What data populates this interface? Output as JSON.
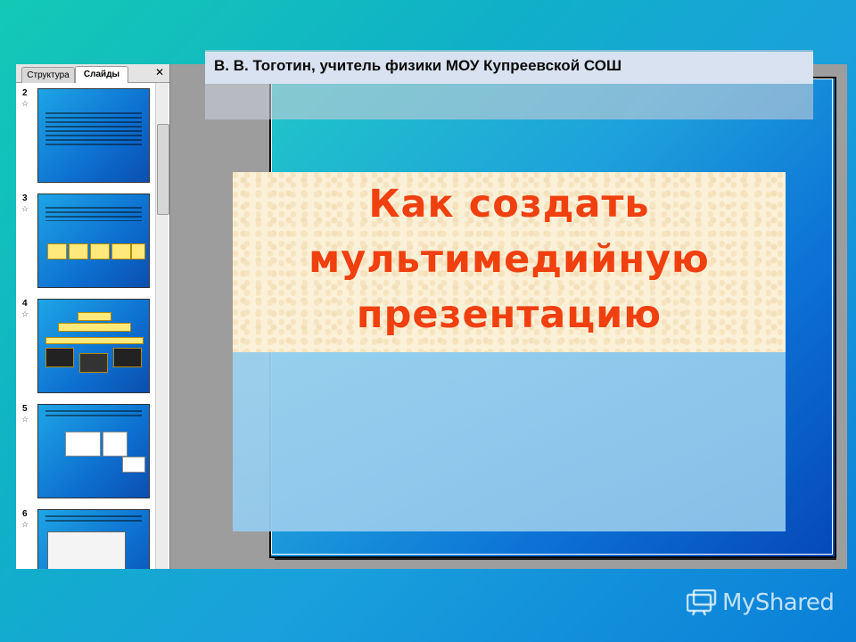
{
  "author_banner": {
    "text": "В. В. Тоготин, учитель физики МОУ Купреевской СОШ"
  },
  "title": {
    "text": "Как создать мультимедийную презентацию"
  },
  "slides_panel": {
    "tabs": [
      {
        "label": "Структура"
      },
      {
        "label": "Слайды"
      }
    ],
    "close_icon": "close-icon",
    "thumbnails": [
      {
        "number": "2",
        "star_icon": "star-icon"
      },
      {
        "number": "3",
        "star_icon": "star-icon"
      },
      {
        "number": "4",
        "star_icon": "star-icon"
      },
      {
        "number": "5",
        "star_icon": "star-icon"
      },
      {
        "number": "6",
        "star_icon": "star-icon"
      }
    ]
  },
  "watermark": {
    "text": "MyShared",
    "icon": "myshared-logo-icon"
  },
  "colors": {
    "title": "#f04010",
    "background": "#10b0c8",
    "slide": "#1ea0dc"
  }
}
